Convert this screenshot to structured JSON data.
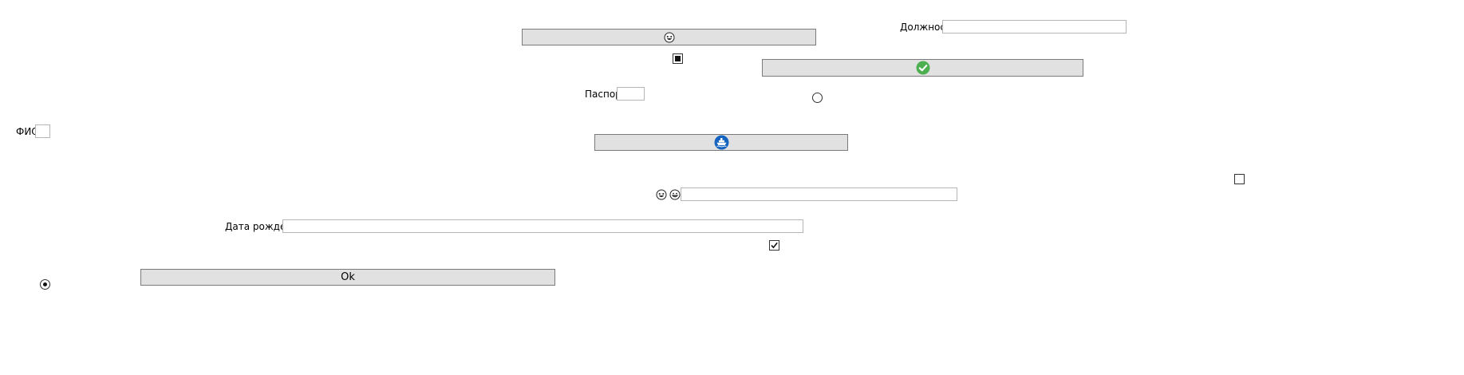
{
  "labels": {
    "position": "Должность",
    "passport": "Паспорт",
    "full_name": "ФИО",
    "birth_date": "Дата рождения"
  },
  "buttons": {
    "ok": "Ok",
    "emoji_button_icon": "laughing-face-icon",
    "check_button_icon": "green-check-icon",
    "ship_button_icon": "ship-icon"
  },
  "icons": {
    "smiley_1": "laughing-face-icon",
    "smiley_2": "grinning-face-icon"
  },
  "colors": {
    "button_bg": "#e1e1e1",
    "check_green": "#4caf50",
    "ship_blue": "#1565c0"
  },
  "states": {
    "checkbox_indeterminate": "indeterminate",
    "checkbox_checked": true,
    "checkbox_unchecked": false,
    "radio_selected": true,
    "radio_unselected": false
  }
}
